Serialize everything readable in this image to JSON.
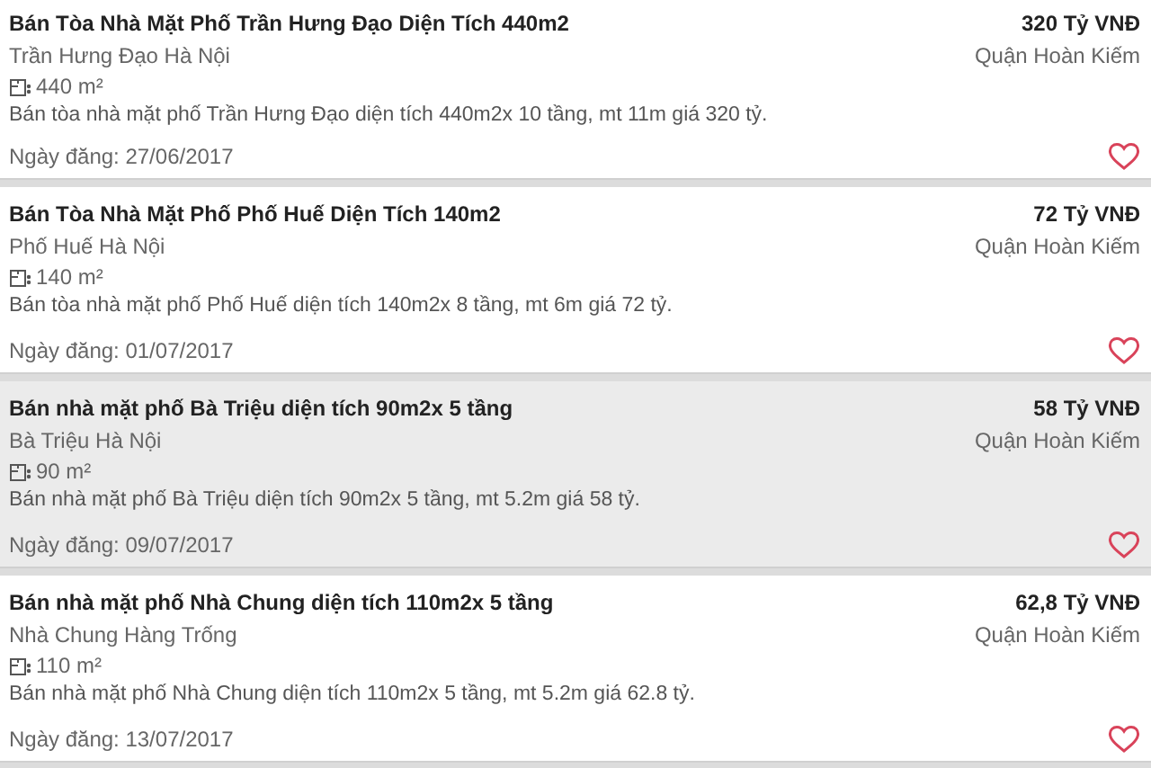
{
  "listings": [
    {
      "title": "Bán Tòa Nhà Mặt Phố Trần Hưng Đạo Diện Tích 440m2",
      "price": "320 Tỷ VNĐ",
      "address": "Trần Hưng Đạo Hà Nội",
      "district": "Quận Hoàn Kiếm",
      "area": "440 m²",
      "description": "Bán tòa nhà mặt phố Trần Hưng Đạo diện tích 440m2x 10 tầng, mt 11m giá 320 tỷ.",
      "date": "Ngày đăng: 27/06/2017",
      "selected": false
    },
    {
      "title": "Bán Tòa Nhà Mặt Phố Phố Huế Diện Tích 140m2",
      "price": "72 Tỷ VNĐ",
      "address": "Phố Huế Hà Nội",
      "district": "Quận Hoàn Kiếm",
      "area": "140 m²",
      "description": "Bán tòa nhà mặt phố Phố Huế diện tích 140m2x 8 tầng, mt 6m giá 72 tỷ.",
      "date": "Ngày đăng: 01/07/2017",
      "selected": false
    },
    {
      "title": "Bán nhà mặt phố Bà Triệu diện tích 90m2x 5 tầng",
      "price": "58 Tỷ VNĐ",
      "address": "Bà Triệu Hà Nội",
      "district": "Quận Hoàn Kiếm",
      "area": "90 m²",
      "description": "Bán nhà mặt phố Bà Triệu diện tích 90m2x 5 tầng, mt 5.2m giá 58 tỷ.",
      "date": "Ngày đăng: 09/07/2017",
      "selected": true
    },
    {
      "title": "Bán nhà mặt phố Nhà Chung diện tích 110m2x 5 tầng",
      "price": "62,8 Tỷ VNĐ",
      "address": "Nhà Chung Hàng Trống",
      "district": "Quận Hoàn Kiếm",
      "area": "110 m²",
      "description": "Bán nhà mặt phố Nhà Chung diện tích 110m2x 5 tầng, mt 5.2m giá 62.8 tỷ.",
      "date": "Ngày đăng: 13/07/2017",
      "selected": false
    }
  ]
}
